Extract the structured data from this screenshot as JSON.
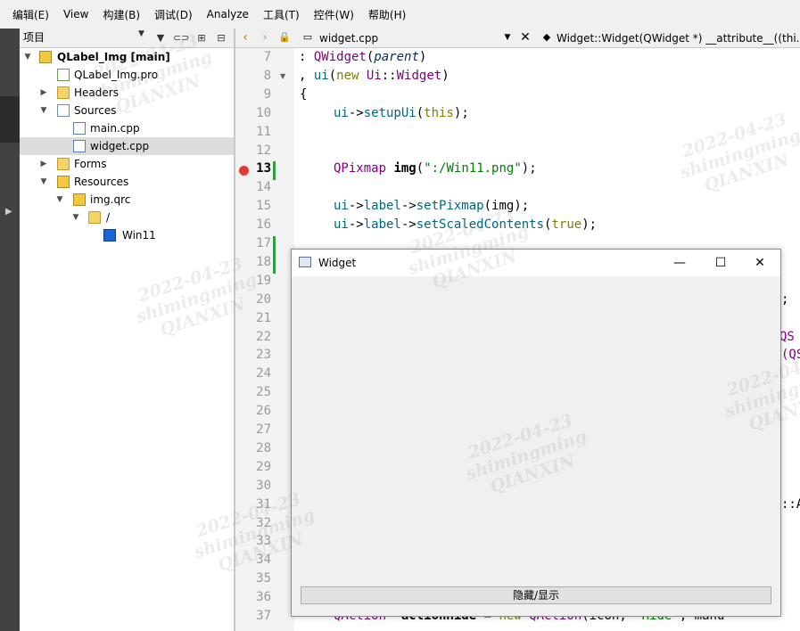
{
  "menubar": {
    "items": [
      "编辑(E)",
      "View",
      "构建(B)",
      "调试(D)",
      "Analyze",
      "工具(T)",
      "控件(W)",
      "帮助(H)"
    ]
  },
  "project_pane": {
    "combo_label": "项目",
    "tree": [
      {
        "label": "QLabel_Img [main]",
        "icon": "project-icon",
        "bold": true
      },
      {
        "label": "QLabel_Img.pro",
        "icon": "pro-file-icon"
      },
      {
        "label": "Headers",
        "icon": "headers-folder-icon"
      },
      {
        "label": "Sources",
        "icon": "sources-folder-icon"
      },
      {
        "label": "main.cpp",
        "icon": "cpp-file-icon"
      },
      {
        "label": "widget.cpp",
        "icon": "cpp-file-icon",
        "selected": true
      },
      {
        "label": "Forms",
        "icon": "forms-folder-icon"
      },
      {
        "label": "Resources",
        "icon": "resources-folder-icon"
      },
      {
        "label": "img.qrc",
        "icon": "qrc-file-icon"
      },
      {
        "label": "/",
        "icon": "folder-icon"
      },
      {
        "label": "Win11",
        "icon": "image-icon"
      }
    ]
  },
  "editor": {
    "file_name": "widget.cpp",
    "symbol": "Widget::Widget(QWidget *) __attribute__((thi...",
    "current_line": 13,
    "line_numbers": [
      "7",
      "8",
      "9",
      "10",
      "11",
      "12",
      "13",
      "14",
      "15",
      "16",
      "17",
      "18",
      "19",
      "20",
      "21",
      "22",
      "23",
      "24",
      "25",
      "26",
      "27",
      "28",
      "29",
      "30",
      "31",
      "32",
      "33",
      "34",
      "35",
      "36",
      "37"
    ],
    "code": {
      "l7": [
        ": ",
        "QWidget",
        "(",
        "parent",
        ")"
      ],
      "l8": [
        ", ",
        "ui",
        "(",
        "new",
        " ",
        "Ui",
        "::",
        "Widget",
        ")"
      ],
      "l9": [
        "{"
      ],
      "l10": [
        "ui",
        "->",
        "setupUi",
        "(",
        "this",
        ");"
      ],
      "l13": [
        "QPixmap",
        " ",
        "img",
        "(",
        "\":/Win11.png\"",
        ");"
      ],
      "l15": [
        "ui",
        "->",
        "label",
        "->",
        "setPixmap",
        "(img);"
      ],
      "l16": [
        "ui",
        "->",
        "label",
        "->",
        "setScaledContents",
        "(",
        "true",
        ");"
      ],
      "l20": [
        ";"
      ],
      "l22": [
        "QS"
      ],
      "l23": [
        "(QS"
      ],
      "l31": [
        "::A"
      ],
      "l37": [
        "QAction *",
        "actionHide",
        " = ",
        "new",
        " ",
        "QAction",
        "(icon, ",
        "\"Hide\"",
        ", manu"
      ]
    }
  },
  "widget_window": {
    "title": "Widget",
    "minimize_glyph": "—",
    "maximize_glyph": "☐",
    "close_glyph": "✕",
    "toggle_button": "隐藏/显示"
  },
  "watermark": {
    "date": "2022-04-23",
    "user": "shimingming",
    "org": "QIANXIN"
  },
  "colors": {
    "keyword": "#808000",
    "type": "#800080",
    "function": "#00677c",
    "string": "#008000",
    "breakpoint": "#e53935",
    "modified_bar": "#2ea043"
  }
}
